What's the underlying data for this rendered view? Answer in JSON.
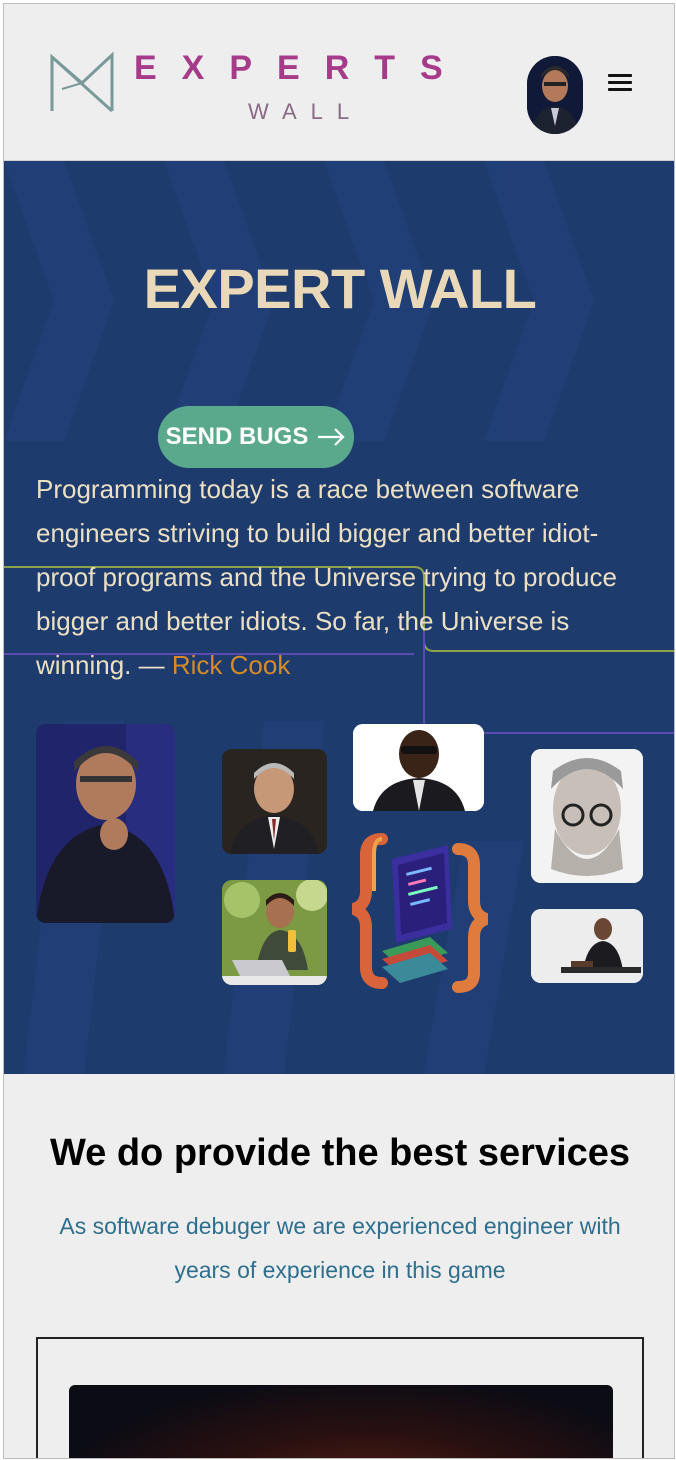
{
  "header": {
    "logo_line1": "EXPERTS",
    "logo_line2": "WALL",
    "menu_icon": "hamburger-icon"
  },
  "hero": {
    "title": "EXPERT WALL",
    "cta_label": "SEND BUGS",
    "cta_icon": "arrow-right-icon",
    "quote_text": "Programming today is a race between software engineers striving to build bigger and better idiot-proof programs and the Universe trying to produce bigger and better idiots. So far, the Universe is winning. — ",
    "quote_author": "Rick Cook"
  },
  "services": {
    "title": "We do provide the best services",
    "subtitle": "As software debuger we are experienced engineer with years of experience in this game"
  },
  "colors": {
    "hero_bg": "#1e3b6d",
    "title_cream": "#ead9b8",
    "cta_green": "#5aa98c",
    "author_orange": "#d58b27",
    "logo_magenta": "#a63b8a",
    "subtitle_teal": "#2f6f8e"
  }
}
